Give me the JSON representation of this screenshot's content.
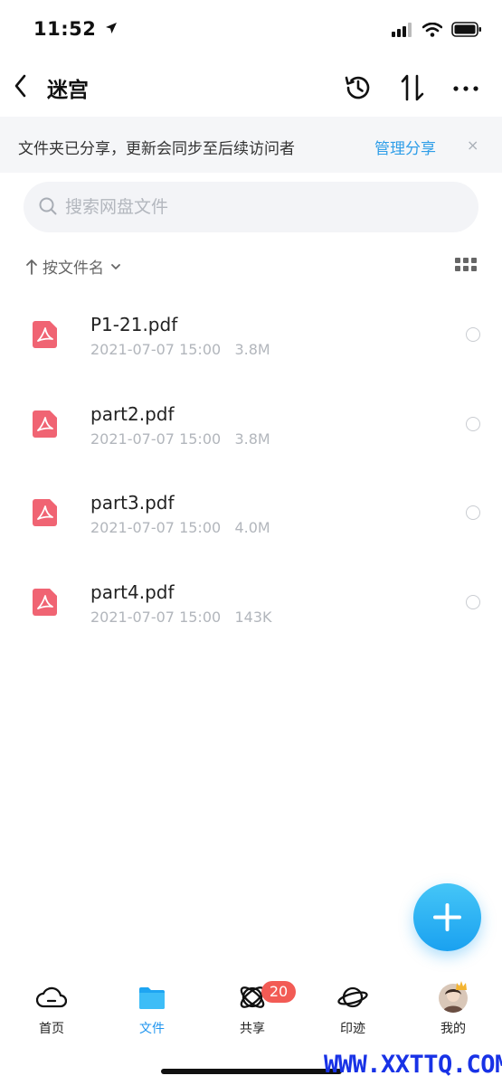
{
  "status_bar": {
    "time": "11:52"
  },
  "header": {
    "title": "迷宫"
  },
  "banner": {
    "text": "文件夹已分享，更新会同步至后续访问者",
    "link": "管理分享",
    "close": "×"
  },
  "search": {
    "placeholder": "搜索网盘文件",
    "value": ""
  },
  "sort": {
    "label": "按文件名"
  },
  "files": [
    {
      "name": "P1-21.pdf",
      "date": "2021-07-07 15:00",
      "size": "3.8M"
    },
    {
      "name": "part2.pdf",
      "date": "2021-07-07 15:00",
      "size": "3.8M"
    },
    {
      "name": "part3.pdf",
      "date": "2021-07-07 15:00",
      "size": "4.0M"
    },
    {
      "name": "part4.pdf",
      "date": "2021-07-07 15:00",
      "size": "143K"
    }
  ],
  "tabs": [
    {
      "label": "首页",
      "icon": "cloud-icon"
    },
    {
      "label": "文件",
      "icon": "folder-icon",
      "active": true
    },
    {
      "label": "共享",
      "icon": "share-orbit-icon",
      "badge": "20"
    },
    {
      "label": "印迹",
      "icon": "planet-icon"
    },
    {
      "label": "我的",
      "icon": "avatar"
    }
  ],
  "watermark": "WWW.XXTTQ.COM",
  "colors": {
    "accent": "#2196ef",
    "pdf": "#f06473",
    "badge": "#f25b55",
    "banner_bg": "#f5f6f8"
  }
}
